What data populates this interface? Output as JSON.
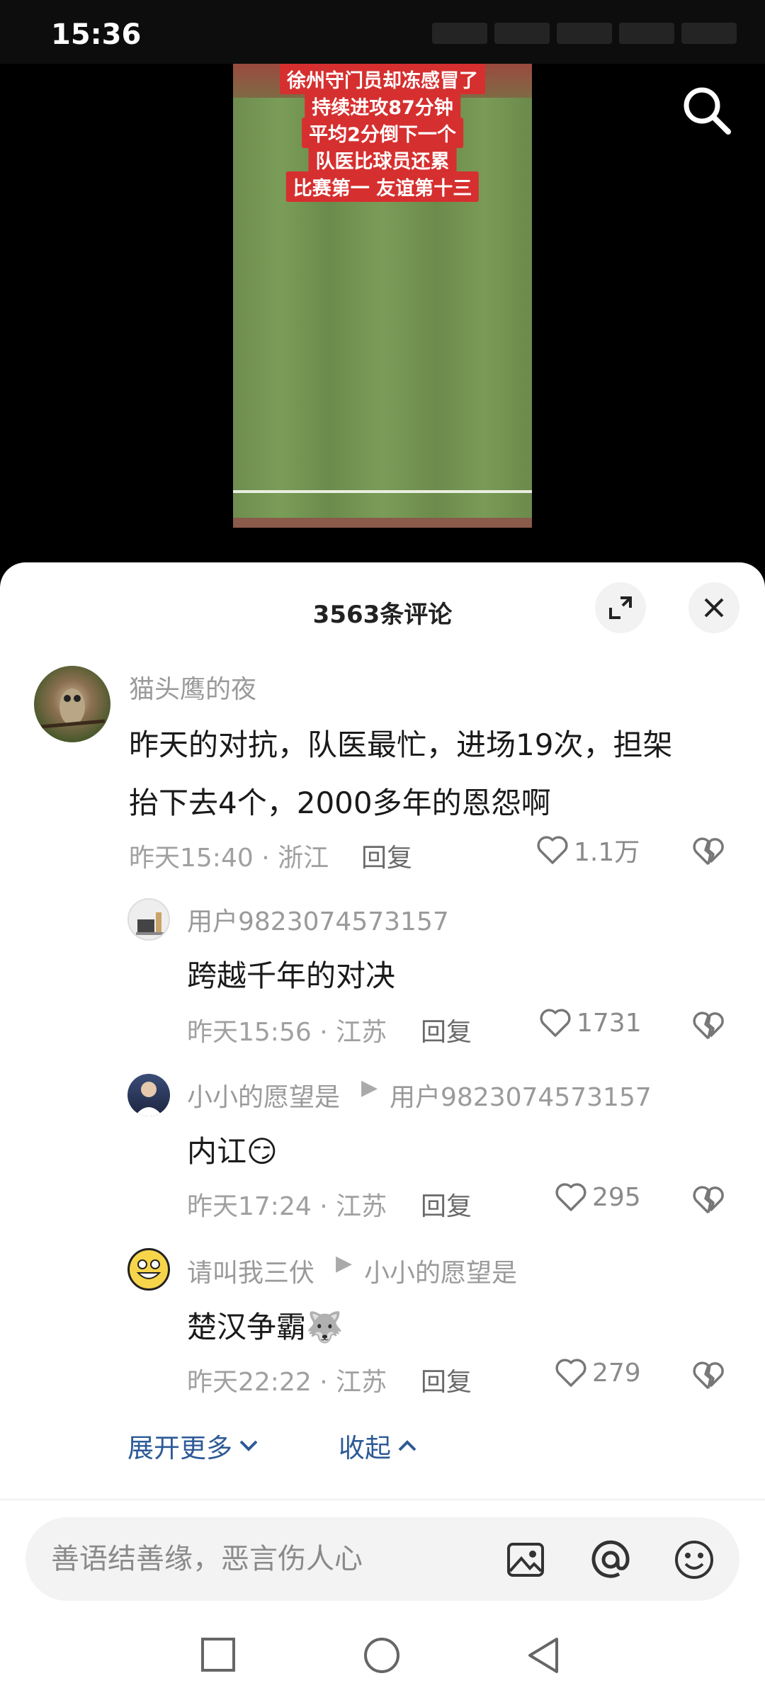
{
  "status_bar": {
    "time": "15:36"
  },
  "video": {
    "captions": [
      "徐州守门员却冻感冒了",
      "持续进攻87分钟",
      "平均2分倒下一个",
      "队医比球员还累",
      "比赛第一 友谊第十三"
    ],
    "search_icon": "search-icon"
  },
  "comments_panel": {
    "title": "3563条评论",
    "expand_icon": "expand-icon",
    "close_icon": "close-icon",
    "colors": {
      "link": "#2d5a96",
      "caption_bg": "#d62f2f"
    },
    "comments": [
      {
        "username": "猫头鹰的夜",
        "text_lines": [
          "昨天的对抗，队医最忙，进场19次，担架",
          "抬下去4个，2000多年的恩怨啊"
        ],
        "meta": "昨天15:40 · 浙江",
        "reply_label": "回复",
        "likes": "1.1万"
      }
    ],
    "replies": [
      {
        "username": "用户9823074573157",
        "reply_to": "",
        "text": "跨越千年的对决",
        "emoji": "",
        "meta": "昨天15:56 · 江苏",
        "reply_label": "回复",
        "likes": "1731"
      },
      {
        "username": "小小的愿望是",
        "reply_to": "用户9823074573157",
        "text": "内讧",
        "emoji": "😏",
        "meta": "昨天17:24 · 江苏",
        "reply_label": "回复",
        "likes": "295"
      },
      {
        "username": "请叫我三伏",
        "reply_to": "小小的愿望是",
        "text": "楚汉争霸",
        "emoji": "🐺",
        "meta": "昨天22:22 · 江苏",
        "reply_label": "回复",
        "likes": "279"
      }
    ],
    "expand_more": "展开更多",
    "collapse": "收起"
  },
  "input_bar": {
    "placeholder": "善语结善缘，恶言伤人心",
    "icons": [
      "image-icon",
      "at-icon",
      "emoji-icon"
    ]
  },
  "nav_bar": {
    "icons": [
      "recents-square-icon",
      "home-circle-icon",
      "back-triangle-icon"
    ]
  }
}
